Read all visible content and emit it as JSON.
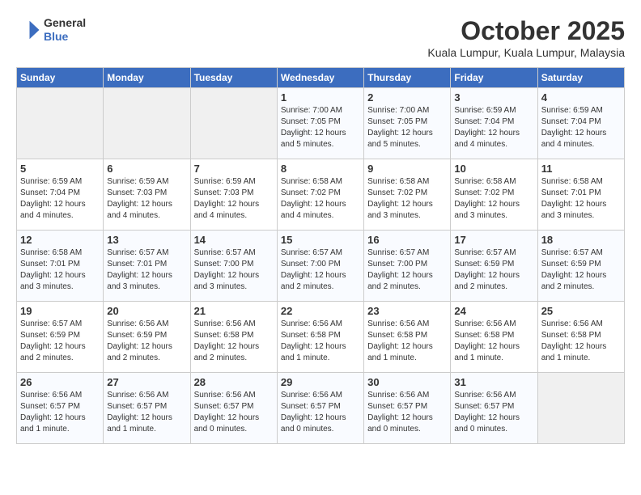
{
  "header": {
    "logo_line1": "General",
    "logo_line2": "Blue",
    "month": "October 2025",
    "location": "Kuala Lumpur, Kuala Lumpur, Malaysia"
  },
  "weekdays": [
    "Sunday",
    "Monday",
    "Tuesday",
    "Wednesday",
    "Thursday",
    "Friday",
    "Saturday"
  ],
  "weeks": [
    [
      {
        "day": null
      },
      {
        "day": null
      },
      {
        "day": null
      },
      {
        "day": "1",
        "sunrise": "Sunrise: 7:00 AM",
        "sunset": "Sunset: 7:05 PM",
        "daylight": "Daylight: 12 hours and 5 minutes."
      },
      {
        "day": "2",
        "sunrise": "Sunrise: 7:00 AM",
        "sunset": "Sunset: 7:05 PM",
        "daylight": "Daylight: 12 hours and 5 minutes."
      },
      {
        "day": "3",
        "sunrise": "Sunrise: 6:59 AM",
        "sunset": "Sunset: 7:04 PM",
        "daylight": "Daylight: 12 hours and 4 minutes."
      },
      {
        "day": "4",
        "sunrise": "Sunrise: 6:59 AM",
        "sunset": "Sunset: 7:04 PM",
        "daylight": "Daylight: 12 hours and 4 minutes."
      }
    ],
    [
      {
        "day": "5",
        "sunrise": "Sunrise: 6:59 AM",
        "sunset": "Sunset: 7:04 PM",
        "daylight": "Daylight: 12 hours and 4 minutes."
      },
      {
        "day": "6",
        "sunrise": "Sunrise: 6:59 AM",
        "sunset": "Sunset: 7:03 PM",
        "daylight": "Daylight: 12 hours and 4 minutes."
      },
      {
        "day": "7",
        "sunrise": "Sunrise: 6:59 AM",
        "sunset": "Sunset: 7:03 PM",
        "daylight": "Daylight: 12 hours and 4 minutes."
      },
      {
        "day": "8",
        "sunrise": "Sunrise: 6:58 AM",
        "sunset": "Sunset: 7:02 PM",
        "daylight": "Daylight: 12 hours and 4 minutes."
      },
      {
        "day": "9",
        "sunrise": "Sunrise: 6:58 AM",
        "sunset": "Sunset: 7:02 PM",
        "daylight": "Daylight: 12 hours and 3 minutes."
      },
      {
        "day": "10",
        "sunrise": "Sunrise: 6:58 AM",
        "sunset": "Sunset: 7:02 PM",
        "daylight": "Daylight: 12 hours and 3 minutes."
      },
      {
        "day": "11",
        "sunrise": "Sunrise: 6:58 AM",
        "sunset": "Sunset: 7:01 PM",
        "daylight": "Daylight: 12 hours and 3 minutes."
      }
    ],
    [
      {
        "day": "12",
        "sunrise": "Sunrise: 6:58 AM",
        "sunset": "Sunset: 7:01 PM",
        "daylight": "Daylight: 12 hours and 3 minutes."
      },
      {
        "day": "13",
        "sunrise": "Sunrise: 6:57 AM",
        "sunset": "Sunset: 7:01 PM",
        "daylight": "Daylight: 12 hours and 3 minutes."
      },
      {
        "day": "14",
        "sunrise": "Sunrise: 6:57 AM",
        "sunset": "Sunset: 7:00 PM",
        "daylight": "Daylight: 12 hours and 3 minutes."
      },
      {
        "day": "15",
        "sunrise": "Sunrise: 6:57 AM",
        "sunset": "Sunset: 7:00 PM",
        "daylight": "Daylight: 12 hours and 2 minutes."
      },
      {
        "day": "16",
        "sunrise": "Sunrise: 6:57 AM",
        "sunset": "Sunset: 7:00 PM",
        "daylight": "Daylight: 12 hours and 2 minutes."
      },
      {
        "day": "17",
        "sunrise": "Sunrise: 6:57 AM",
        "sunset": "Sunset: 6:59 PM",
        "daylight": "Daylight: 12 hours and 2 minutes."
      },
      {
        "day": "18",
        "sunrise": "Sunrise: 6:57 AM",
        "sunset": "Sunset: 6:59 PM",
        "daylight": "Daylight: 12 hours and 2 minutes."
      }
    ],
    [
      {
        "day": "19",
        "sunrise": "Sunrise: 6:57 AM",
        "sunset": "Sunset: 6:59 PM",
        "daylight": "Daylight: 12 hours and 2 minutes."
      },
      {
        "day": "20",
        "sunrise": "Sunrise: 6:56 AM",
        "sunset": "Sunset: 6:59 PM",
        "daylight": "Daylight: 12 hours and 2 minutes."
      },
      {
        "day": "21",
        "sunrise": "Sunrise: 6:56 AM",
        "sunset": "Sunset: 6:58 PM",
        "daylight": "Daylight: 12 hours and 2 minutes."
      },
      {
        "day": "22",
        "sunrise": "Sunrise: 6:56 AM",
        "sunset": "Sunset: 6:58 PM",
        "daylight": "Daylight: 12 hours and 1 minute."
      },
      {
        "day": "23",
        "sunrise": "Sunrise: 6:56 AM",
        "sunset": "Sunset: 6:58 PM",
        "daylight": "Daylight: 12 hours and 1 minute."
      },
      {
        "day": "24",
        "sunrise": "Sunrise: 6:56 AM",
        "sunset": "Sunset: 6:58 PM",
        "daylight": "Daylight: 12 hours and 1 minute."
      },
      {
        "day": "25",
        "sunrise": "Sunrise: 6:56 AM",
        "sunset": "Sunset: 6:58 PM",
        "daylight": "Daylight: 12 hours and 1 minute."
      }
    ],
    [
      {
        "day": "26",
        "sunrise": "Sunrise: 6:56 AM",
        "sunset": "Sunset: 6:57 PM",
        "daylight": "Daylight: 12 hours and 1 minute."
      },
      {
        "day": "27",
        "sunrise": "Sunrise: 6:56 AM",
        "sunset": "Sunset: 6:57 PM",
        "daylight": "Daylight: 12 hours and 1 minute."
      },
      {
        "day": "28",
        "sunrise": "Sunrise: 6:56 AM",
        "sunset": "Sunset: 6:57 PM",
        "daylight": "Daylight: 12 hours and 0 minutes."
      },
      {
        "day": "29",
        "sunrise": "Sunrise: 6:56 AM",
        "sunset": "Sunset: 6:57 PM",
        "daylight": "Daylight: 12 hours and 0 minutes."
      },
      {
        "day": "30",
        "sunrise": "Sunrise: 6:56 AM",
        "sunset": "Sunset: 6:57 PM",
        "daylight": "Daylight: 12 hours and 0 minutes."
      },
      {
        "day": "31",
        "sunrise": "Sunrise: 6:56 AM",
        "sunset": "Sunset: 6:57 PM",
        "daylight": "Daylight: 12 hours and 0 minutes."
      },
      {
        "day": null
      }
    ]
  ]
}
